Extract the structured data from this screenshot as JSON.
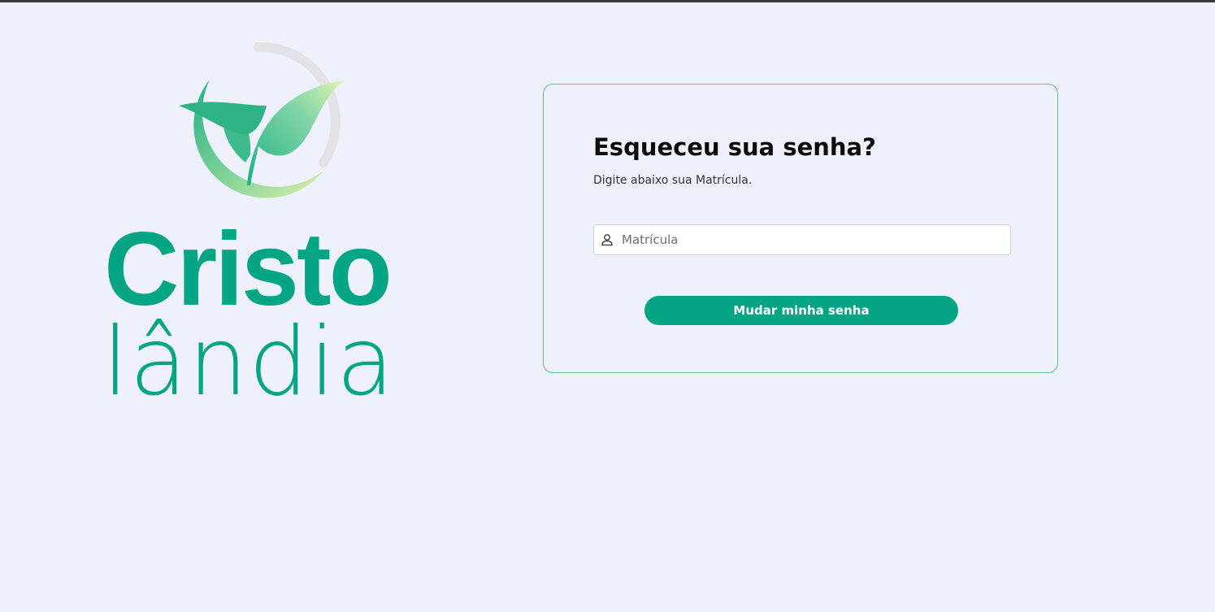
{
  "logo": {
    "word_1": "Cristo",
    "word_2": "lândia",
    "emblem_icon": "leaf-emblem-icon",
    "brand_color": "#04a584"
  },
  "form": {
    "title": "Esqueceu sua senha?",
    "subtitle": "Digite abaixo sua Matrícula.",
    "matricula_placeholder": "Matrícula",
    "matricula_value": "",
    "matricula_icon": "user-icon",
    "submit_label": "Mudar minha senha"
  },
  "colors": {
    "background": "#eef0fc",
    "accent": "#04a584",
    "card_border": "#5fbf8c"
  }
}
